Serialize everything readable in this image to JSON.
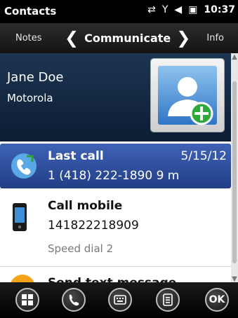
{
  "statusbar": {
    "title": "Contacts",
    "time": "10:37",
    "icons": [
      "network-activity-icon",
      "signal-icon",
      "volume-icon",
      "battery-charging-icon"
    ]
  },
  "navbar": {
    "left_tab": "Notes",
    "center_tab": "Communicate",
    "right_tab": "Info",
    "prev_glyph": "❮",
    "next_glyph": "❯"
  },
  "contact": {
    "name": "Jane Doe",
    "company": "Motorola",
    "avatar_icon": "contact-add-photo-icon"
  },
  "list": {
    "last_call": {
      "label": "Last call",
      "date": "5/15/12",
      "details": "1 (418) 222-1890 9 m",
      "icon": "incoming-call-icon"
    },
    "call_mobile": {
      "label": "Call mobile",
      "number": "141822218909",
      "speed_dial": "Speed dial 2",
      "icon": "mobile-phone-icon"
    },
    "send_text": {
      "label": "Send text message",
      "icon": "message-icon"
    }
  },
  "softkeys": {
    "start_icon": "windows-start-icon",
    "phone_icon": "phone-icon",
    "keyboard_icon": "keyboard-icon",
    "menu_icon": "menu-icon",
    "ok_label": "OK"
  },
  "colors": {
    "selection": "#2f52a4",
    "header_bg": "#163050",
    "statusbar_bg": "#000000"
  }
}
